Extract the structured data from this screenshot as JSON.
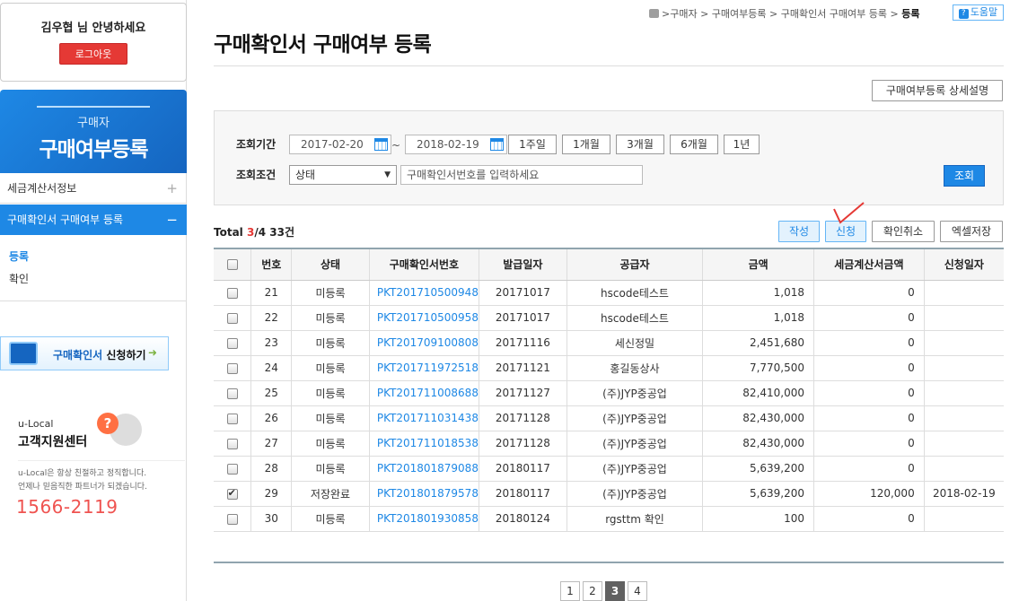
{
  "sidebar": {
    "greeting": "김우협 님 안녕하세요",
    "logout_label": "로그아웃",
    "banner_sub": "구매자",
    "banner_title": "구매여부등록",
    "menu": [
      {
        "label": "세금계산서정보",
        "sign": "+"
      },
      {
        "label": "구매확인서 구매여부 등록",
        "sign": "−"
      }
    ],
    "submenu": [
      "등록",
      "확인"
    ],
    "apply_banner": {
      "text_blue": "구매확인서",
      "text_dark": " 신청하기"
    },
    "cs": {
      "small": "u-Local",
      "big": "고객지원센터",
      "desc_line1": "u-Local은 항상 친절하고 정직합니다.",
      "desc_line2": "언제나 믿음직한 파트너가 되겠습니다.",
      "phone": "1566-2119"
    }
  },
  "header": {
    "breadcrumb": ">구매자 > 구매여부등록 > 구매확인서 구매여부 등록 > ",
    "breadcrumb_current": "등록",
    "help_label": "도움말",
    "page_title": "구매확인서 구매여부 등록",
    "detail_button": "구매여부등록 상세설명"
  },
  "search": {
    "period_label": "조회기간",
    "date_from": "2017-02-20",
    "tilde": "~",
    "date_to": "2018-02-19",
    "period_buttons": [
      "1주일",
      "1개월",
      "3개월",
      "6개월",
      "1년"
    ],
    "condition_label": "조회조건",
    "status_select": "상태",
    "search_placeholder": "구매확인서번호를 입력하세요",
    "search_button": "조회"
  },
  "toolbar": {
    "total_prefix": "Total ",
    "total_page": "3",
    "total_rest": "/4 33건",
    "buttons": [
      "작성",
      "신청",
      "확인취소",
      "엑셀저장"
    ]
  },
  "table": {
    "columns": [
      "번호",
      "상태",
      "구매확인서번호",
      "발급일자",
      "공급자",
      "금액",
      "세금계산서금액",
      "신청일자"
    ],
    "rows": [
      {
        "checked": false,
        "no": "21",
        "status": "미등록",
        "doc": "PKT201710500948",
        "date": "20171017",
        "supplier": "hscode테스트",
        "amount": "1,018",
        "tax": "0",
        "apply": ""
      },
      {
        "checked": false,
        "no": "22",
        "status": "미등록",
        "doc": "PKT201710500958",
        "date": "20171017",
        "supplier": "hscode테스트",
        "amount": "1,018",
        "tax": "0",
        "apply": ""
      },
      {
        "checked": false,
        "no": "23",
        "status": "미등록",
        "doc": "PKT201709100808",
        "date": "20171116",
        "supplier": "세신정밀",
        "amount": "2,451,680",
        "tax": "0",
        "apply": ""
      },
      {
        "checked": false,
        "no": "24",
        "status": "미등록",
        "doc": "PKT201711972518",
        "date": "20171121",
        "supplier": "홍길동상사",
        "amount": "7,770,500",
        "tax": "0",
        "apply": ""
      },
      {
        "checked": false,
        "no": "25",
        "status": "미등록",
        "doc": "PKT201711008688",
        "date": "20171127",
        "supplier": "(주)JYP중공업",
        "amount": "82,410,000",
        "tax": "0",
        "apply": ""
      },
      {
        "checked": false,
        "no": "26",
        "status": "미등록",
        "doc": "PKT201711031438",
        "date": "20171128",
        "supplier": "(주)JYP중공업",
        "amount": "82,430,000",
        "tax": "0",
        "apply": ""
      },
      {
        "checked": false,
        "no": "27",
        "status": "미등록",
        "doc": "PKT201711018538",
        "date": "20171128",
        "supplier": "(주)JYP중공업",
        "amount": "82,430,000",
        "tax": "0",
        "apply": ""
      },
      {
        "checked": false,
        "no": "28",
        "status": "미등록",
        "doc": "PKT201801879088",
        "date": "20180117",
        "supplier": "(주)JYP중공업",
        "amount": "5,639,200",
        "tax": "0",
        "apply": ""
      },
      {
        "checked": true,
        "no": "29",
        "status": "저장완료",
        "doc": "PKT201801879578",
        "date": "20180117",
        "supplier": "(주)JYP중공업",
        "amount": "5,639,200",
        "tax": "120,000",
        "apply": "2018-02-19"
      },
      {
        "checked": false,
        "no": "30",
        "status": "미등록",
        "doc": "PKT201801930858",
        "date": "20180124",
        "supplier": "rgsttm 확인",
        "amount": "100",
        "tax": "0",
        "apply": ""
      }
    ]
  },
  "pagination": {
    "pages": [
      "1",
      "2",
      "3",
      "4"
    ],
    "current": "3"
  },
  "colors": {
    "accent": "#1e88e5",
    "logout": "#e53935",
    "header_line": "#90a4ae",
    "annotation": "#e53935"
  }
}
